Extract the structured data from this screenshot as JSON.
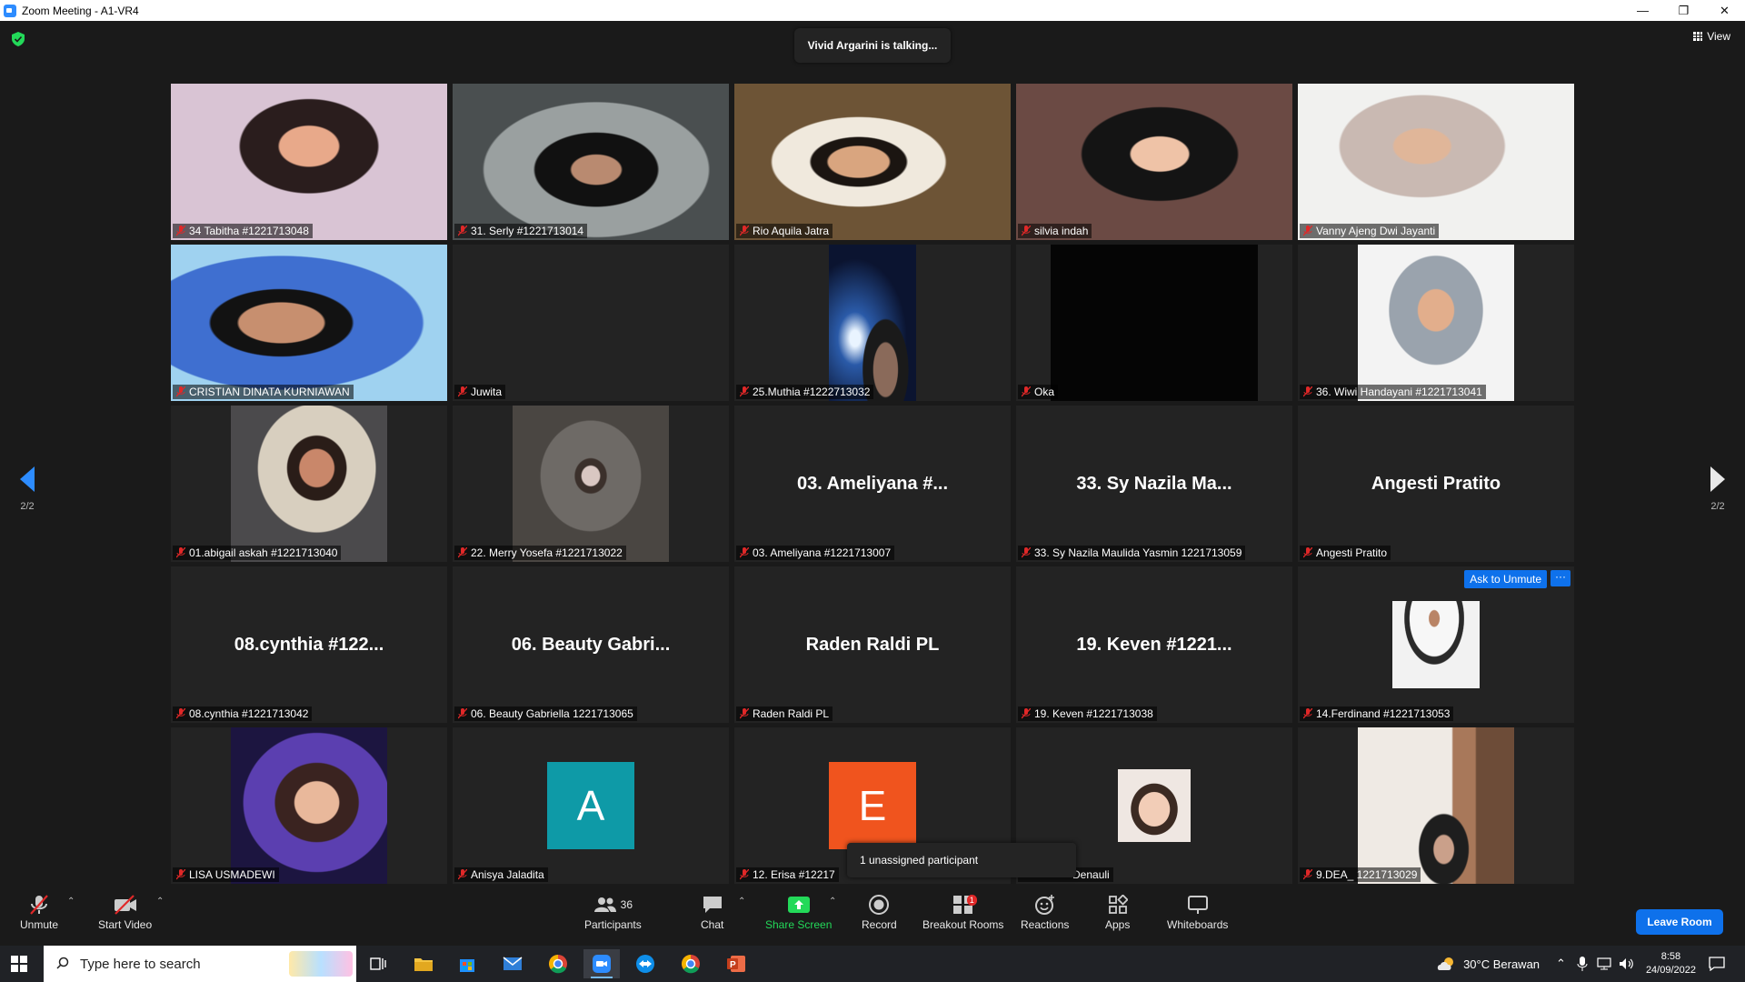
{
  "window": {
    "title": "Zoom Meeting - A1-VR4",
    "controls": [
      "—",
      "❐",
      "✕"
    ]
  },
  "meeting": {
    "talking_banner": "Vivid Argarini is talking...",
    "view_label": "View",
    "page_indicator_left": "2/2",
    "page_indicator_right": "2/2",
    "ask_to_unmute": "Ask to Unmute",
    "more_label": "···",
    "unassigned_tooltip": "1 unassigned participant"
  },
  "tiles": [
    {
      "label": "34 Tabitha #1221713048",
      "type": "video"
    },
    {
      "label": "31. Serly #1221713014",
      "type": "video"
    },
    {
      "label": "Rio Aquila Jatra",
      "type": "video"
    },
    {
      "label": "silvia indah",
      "type": "video"
    },
    {
      "label": "Vanny Ajeng Dwi Jayanti",
      "type": "video"
    },
    {
      "label": "CRISTIAN DINATA KURNIAWAN",
      "type": "video"
    },
    {
      "label": "Juwita",
      "type": "empty"
    },
    {
      "label": "25.Muthia #1222713032",
      "type": "video"
    },
    {
      "label": "Oka",
      "type": "video"
    },
    {
      "label": "36. Wiwi Handayani #1221713041",
      "type": "photo"
    },
    {
      "label": "01.abigail askah #1221713040",
      "type": "photo"
    },
    {
      "label": "22. Merry Yosefa #1221713022",
      "type": "photo"
    },
    {
      "label": "03. Ameliyana #1221713007",
      "type": "name",
      "display_name": "03. Ameliyana #..."
    },
    {
      "label": "33. Sy Nazila Maulida Yasmin 1221713059",
      "type": "name",
      "display_name": "33. Sy Nazila Ma..."
    },
    {
      "label": "Angesti Pratito",
      "type": "name",
      "display_name": "Angesti Pratito"
    },
    {
      "label": "08.cynthia #1221713042",
      "type": "name",
      "display_name": "08.cynthia #122..."
    },
    {
      "label": "06. Beauty Gabriella 1221713065",
      "type": "name",
      "display_name": "06. Beauty Gabri..."
    },
    {
      "label": "Raden Raldi PL",
      "type": "name",
      "display_name": "Raden Raldi PL"
    },
    {
      "label": "19. Keven #1221713038",
      "type": "name",
      "display_name": "19. Keven #1221..."
    },
    {
      "label": "14.Ferdinand #1221713053",
      "type": "photo"
    },
    {
      "label": "LISA USMADEWI",
      "type": "photo"
    },
    {
      "label": "Anisya Jaladita",
      "type": "letter",
      "letter": "A",
      "color": "#0e9aa7"
    },
    {
      "label": "12. Erisa #12217",
      "type": "letter",
      "letter": "E",
      "color": "#f0541e"
    },
    {
      "label": "Denauli",
      "type": "photo"
    },
    {
      "label": "9.DEA_ 1221713029",
      "type": "photo"
    }
  ],
  "toolbar": {
    "unmute": "Unmute",
    "start_video": "Start Video",
    "participants": "Participants",
    "participants_count": "36",
    "chat": "Chat",
    "share_screen": "Share Screen",
    "record": "Record",
    "breakout_rooms": "Breakout Rooms",
    "breakout_badge": "1",
    "reactions": "Reactions",
    "apps": "Apps",
    "whiteboards": "Whiteboards",
    "leave_room": "Leave Room"
  },
  "taskbar": {
    "search_placeholder": "Type here to search",
    "weather": "30°C  Berawan",
    "time": "8:58",
    "date": "24/09/2022"
  },
  "colors": {
    "accent": "#0e71eb",
    "share_green": "#23d959",
    "mute_red": "#e02828"
  }
}
